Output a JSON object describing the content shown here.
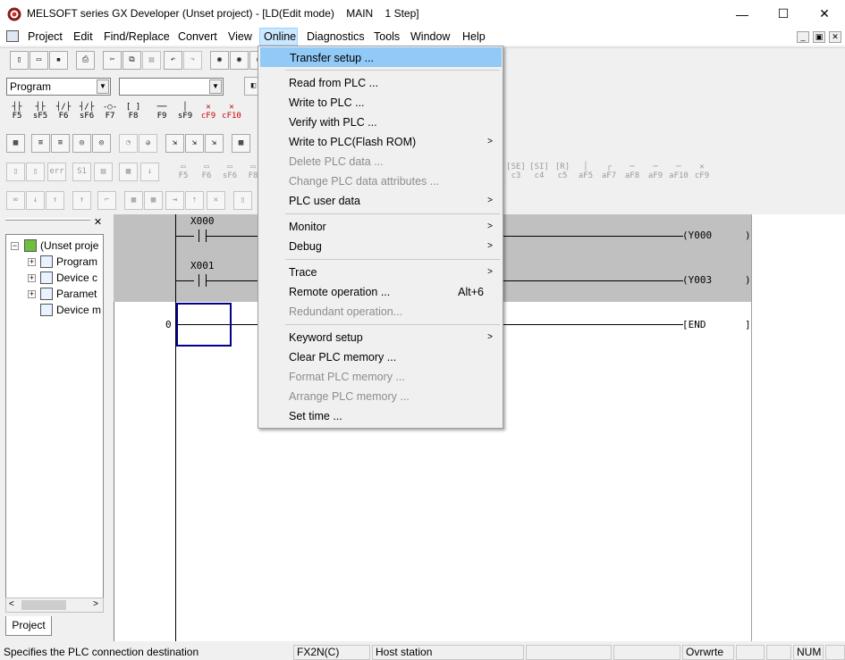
{
  "window": {
    "title": "MELSOFT series GX Developer (Unset project) - [LD(Edit mode)    MAIN    1 Step]",
    "minimize": "—",
    "maximize": "☐",
    "close": "✕"
  },
  "menubar": {
    "items": [
      "Project",
      "Edit",
      "Find/Replace",
      "Convert",
      "View",
      "Online",
      "Diagnostics",
      "Tools",
      "Window",
      "Help"
    ],
    "active": "Online",
    "mdi_minimize": "_",
    "mdi_restore": "▣",
    "mdi_close": "✕"
  },
  "toolbar": {
    "program_combo": "Program",
    "second_combo": ""
  },
  "function_keys": {
    "row1": [
      "F5",
      "sF5",
      "F6",
      "sF6",
      "F7",
      "F8",
      "F9",
      "sF9",
      "cF9",
      "cF10"
    ],
    "row2_partial": [
      "F5",
      "F6",
      "sF6",
      "F8"
    ],
    "row2_right": [
      "c3",
      "c4",
      "c5",
      "aF5",
      "aF7",
      "aF8",
      "aF9",
      "aF10",
      "cF9"
    ]
  },
  "project_tree": {
    "root": "(Unset proje",
    "children": [
      "Program",
      "Device c",
      "Paramet",
      "Device m"
    ],
    "tab": "Project"
  },
  "ladder": {
    "rungs": [
      {
        "contact": "X000",
        "coil": "Y000"
      },
      {
        "contact": "X001",
        "coil": "Y003"
      }
    ],
    "step": "0",
    "end": "END"
  },
  "online_menu": {
    "items": [
      {
        "label": "Transfer setup ...",
        "disabled": false,
        "submenu": false,
        "shortcut": "",
        "selected": true
      },
      {
        "label": "Read from PLC ...",
        "disabled": false,
        "submenu": false,
        "shortcut": ""
      },
      {
        "label": "Write to PLC ...",
        "disabled": false,
        "submenu": false,
        "shortcut": ""
      },
      {
        "label": "Verify with PLC ...",
        "disabled": false,
        "submenu": false,
        "shortcut": ""
      },
      {
        "label": "Write to PLC(Flash ROM)",
        "disabled": false,
        "submenu": true,
        "shortcut": ""
      },
      {
        "label": "Delete PLC data ...",
        "disabled": true,
        "submenu": false,
        "shortcut": ""
      },
      {
        "label": "Change PLC data attributes ...",
        "disabled": true,
        "submenu": false,
        "shortcut": ""
      },
      {
        "label": "PLC user data",
        "disabled": false,
        "submenu": true,
        "shortcut": ""
      },
      {
        "label": "Monitor",
        "disabled": false,
        "submenu": true,
        "shortcut": ""
      },
      {
        "label": "Debug",
        "disabled": false,
        "submenu": true,
        "shortcut": ""
      },
      {
        "label": "Trace",
        "disabled": false,
        "submenu": true,
        "shortcut": ""
      },
      {
        "label": "Remote operation ...",
        "disabled": false,
        "submenu": false,
        "shortcut": "Alt+6"
      },
      {
        "label": "Redundant operation...",
        "disabled": true,
        "submenu": false,
        "shortcut": ""
      },
      {
        "label": "Keyword setup",
        "disabled": false,
        "submenu": true,
        "shortcut": ""
      },
      {
        "label": "Clear PLC memory ...",
        "disabled": false,
        "submenu": false,
        "shortcut": ""
      },
      {
        "label": "Format PLC memory ...",
        "disabled": true,
        "submenu": false,
        "shortcut": ""
      },
      {
        "label": "Arrange PLC memory ...",
        "disabled": true,
        "submenu": false,
        "shortcut": ""
      },
      {
        "label": "Set time ...",
        "disabled": false,
        "submenu": false,
        "shortcut": ""
      }
    ]
  },
  "statusbar": {
    "message": "Specifies the PLC connection destination",
    "plc_type": "FX2N(C)",
    "station": "Host station",
    "mode": "Ovrwrte",
    "num": "NUM"
  },
  "colors": {
    "menu_selected": "#91c9f7",
    "menubar_active": "#cce8ff",
    "ladder_selection": "#00008b",
    "editor_gray": "#c0c0c0"
  }
}
